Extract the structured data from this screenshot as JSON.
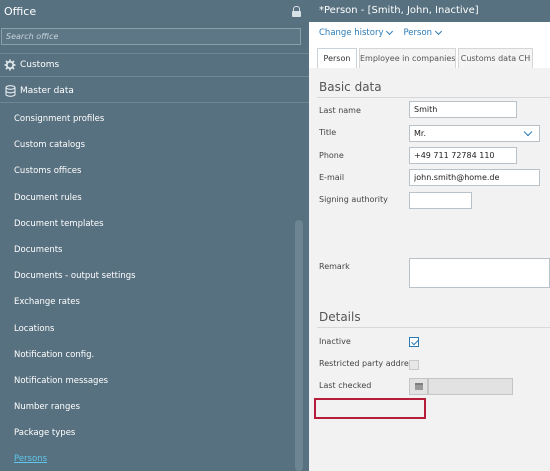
{
  "office": {
    "title": "Office",
    "search_placeholder": "Search office",
    "customs_label": "Customs",
    "master_data_label": "Master data",
    "items": [
      {
        "label": "Consignment profiles"
      },
      {
        "label": "Custom catalogs"
      },
      {
        "label": "Customs offices"
      },
      {
        "label": "Document rules"
      },
      {
        "label": "Document templates"
      },
      {
        "label": "Documents"
      },
      {
        "label": "Documents - output settings"
      },
      {
        "label": "Exchange rates"
      },
      {
        "label": "Locations"
      },
      {
        "label": "Notification config."
      },
      {
        "label": "Notification messages"
      },
      {
        "label": "Number ranges"
      },
      {
        "label": "Package types"
      },
      {
        "label": "Persons",
        "active": true
      }
    ]
  },
  "person": {
    "title": "*Person - [Smith, John, Inactive]",
    "toolbar": {
      "change_history": "Change history",
      "person": "Person"
    },
    "tabs": [
      "Person",
      "Employee in companies",
      "Customs data CH"
    ],
    "active_tab": "Person",
    "basic_data": {
      "heading": "Basic data",
      "last_name_label": "Last name",
      "last_name": "Smith",
      "title_label": "Title",
      "title": "Mr.",
      "phone_label": "Phone",
      "phone": "+49 711 72784 110",
      "email_label": "E-mail",
      "email": "john.smith@home.de",
      "signing_label": "Signing authority",
      "signing": "",
      "remark_label": "Remark",
      "remark": ""
    },
    "details": {
      "heading": "Details",
      "inactive_label": "Inactive",
      "inactive": true,
      "restricted_label": "Restricted party addre...",
      "restricted": false,
      "last_checked_label": "Last checked",
      "last_checked": ""
    }
  },
  "colors": {
    "panel": "#587180",
    "accent": "#2a7bb8",
    "highlight": "#b51d3a",
    "active_link": "#5ec8ec"
  }
}
